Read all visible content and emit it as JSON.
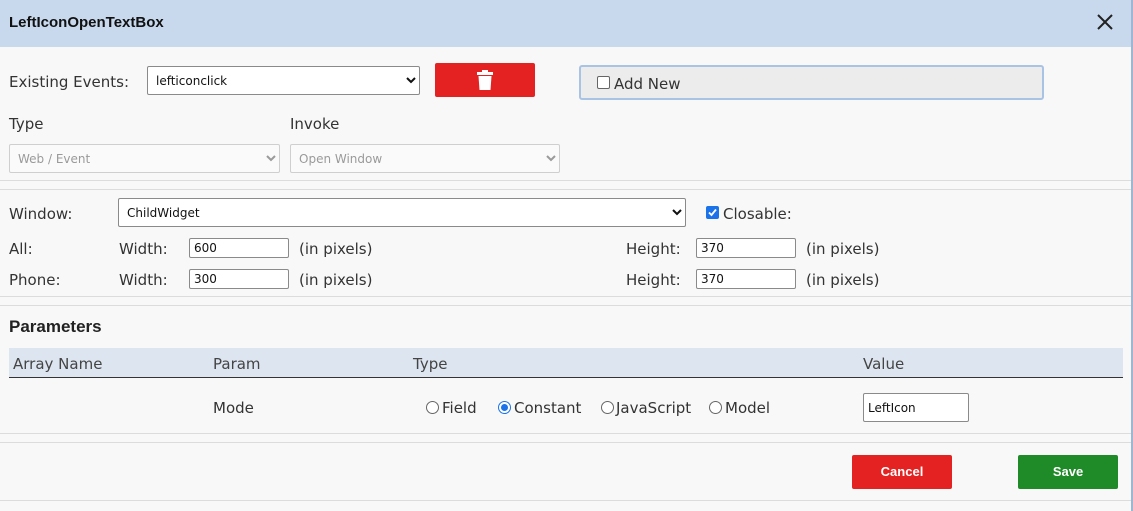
{
  "dialog": {
    "title": "LeftIconOpenTextBox"
  },
  "events": {
    "existing_label": "Existing Events:",
    "selected_event": "lefticonclick",
    "add_new_label": "Add New",
    "add_new_checked": false
  },
  "type_invoke": {
    "type_label": "Type",
    "type_value": "Web / Event",
    "invoke_label": "Invoke",
    "invoke_value": "Open Window"
  },
  "window": {
    "label": "Window:",
    "value": "ChildWidget",
    "closable_label": "Closable:",
    "closable_checked": true,
    "rows": [
      {
        "name": "All:",
        "width_label": "Width:",
        "width": "600",
        "width_unit": "(in pixels)",
        "height_label": "Height:",
        "height": "370",
        "height_unit": "(in pixels)"
      },
      {
        "name": "Phone:",
        "width_label": "Width:",
        "width": "300",
        "width_unit": "(in pixels)",
        "height_label": "Height:",
        "height": "370",
        "height_unit": "(in pixels)"
      }
    ]
  },
  "parameters": {
    "title": "Parameters",
    "columns": [
      "Array Name",
      "Param",
      "Type",
      "Value"
    ],
    "rows": [
      {
        "array_name": "",
        "param": "Mode",
        "type_options": [
          "Field",
          "Constant",
          "JavaScript",
          "Model"
        ],
        "selected_type": "Constant",
        "value": "LeftIcon"
      }
    ]
  },
  "actions": {
    "cancel": "Cancel",
    "save": "Save"
  },
  "colors": {
    "titlebar": "#c8d9ee",
    "danger": "#e52222",
    "success": "#1f8a28",
    "accent": "#1a73e8"
  },
  "icons": {
    "close": "close-icon",
    "delete": "trash-icon",
    "dropdown": "chevron-down-icon"
  }
}
